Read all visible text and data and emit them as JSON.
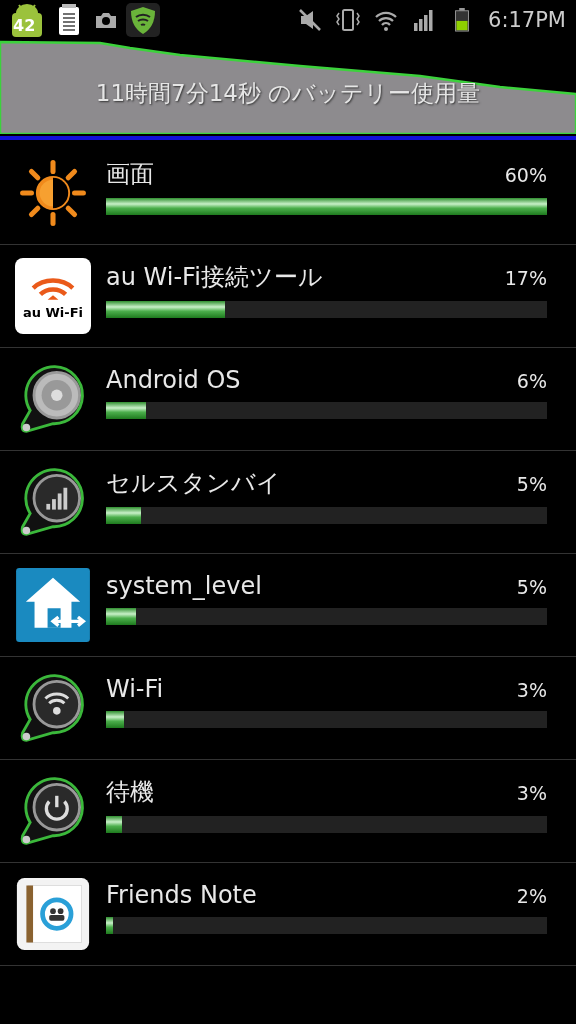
{
  "status_bar": {
    "notification_badge": "42",
    "time": "6:17PM"
  },
  "header": {
    "title": "11時間7分14秒 のバッテリー使用量"
  },
  "items": [
    {
      "kind": "brightness",
      "name": "画面",
      "percent": "60%",
      "level": 1.0
    },
    {
      "kind": "au-wifi",
      "name": "au Wi-Fi接続ツール",
      "percent": "17%",
      "level": 0.27,
      "icon_text": "au Wi-Fi"
    },
    {
      "kind": "gauge-disc",
      "name": "Android OS",
      "percent": "6%",
      "level": 0.09
    },
    {
      "kind": "gauge-signal",
      "name": "セルスタンバイ",
      "percent": "5%",
      "level": 0.08
    },
    {
      "kind": "house",
      "name": "system_level",
      "percent": "5%",
      "level": 0.068
    },
    {
      "kind": "gauge-wifi",
      "name": "Wi-Fi",
      "percent": "3%",
      "level": 0.04
    },
    {
      "kind": "gauge-power",
      "name": "待機",
      "percent": "3%",
      "level": 0.037
    },
    {
      "kind": "notebook",
      "name": "Friends Note",
      "percent": "2%",
      "level": 0.015
    }
  ]
}
